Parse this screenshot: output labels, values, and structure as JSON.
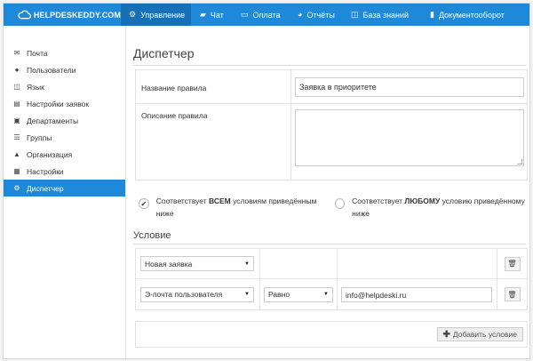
{
  "app": {
    "logo_text": "HELPDESKEDDY.COM",
    "accent": "#1e88d9"
  },
  "topnav": [
    {
      "label": "Управление",
      "icon": "gear-icon",
      "active": true
    },
    {
      "label": "Чат",
      "icon": "chat-icon",
      "active": false
    },
    {
      "label": "Оплата",
      "icon": "credit-card-icon",
      "active": false
    },
    {
      "label": "Отчёты",
      "icon": "pie-chart-icon",
      "active": false
    },
    {
      "label": "База знаний",
      "icon": "book-icon",
      "active": false
    },
    {
      "label": "Документооборот",
      "icon": "document-icon",
      "active": false
    }
  ],
  "sidebar": {
    "items": [
      {
        "label": "Почта",
        "icon": "envelope-icon"
      },
      {
        "label": "Пользователи",
        "icon": "user-icon"
      },
      {
        "label": "Язык",
        "icon": "book-icon"
      },
      {
        "label": "Настройки заявок",
        "icon": "clipboard-icon"
      },
      {
        "label": "Департаменты",
        "icon": "id-card-icon"
      },
      {
        "label": "Группы",
        "icon": "list-icon"
      },
      {
        "label": "Организация",
        "icon": "organization-icon"
      },
      {
        "label": "Настройки",
        "icon": "settings-icon"
      },
      {
        "label": "Диспетчер",
        "icon": "gear-icon",
        "active": true
      }
    ]
  },
  "main": {
    "title": "Диспетчер",
    "rule_name_label": "Название правила",
    "rule_name_value": "Заявка в приоритете",
    "rule_desc_label": "Описание правила",
    "rule_desc_value": "",
    "match_all": {
      "prefix": "Соответствует ",
      "bold": "ВСЕМ",
      "suffix": " условиям приведённым ниже",
      "selected": true
    },
    "match_any": {
      "prefix": "Соответствует ",
      "bold": "ЛЮБОМУ",
      "suffix": " условию приведённому ниже",
      "selected": false
    },
    "condition_title": "Условие",
    "conditions": [
      {
        "field": "Новая заявка",
        "operator": "",
        "value": ""
      },
      {
        "field": "Э-почта пользователя",
        "operator": "Равно",
        "value": "info@helpdeski.ru"
      }
    ],
    "add_condition_label": "Добавить условие"
  }
}
